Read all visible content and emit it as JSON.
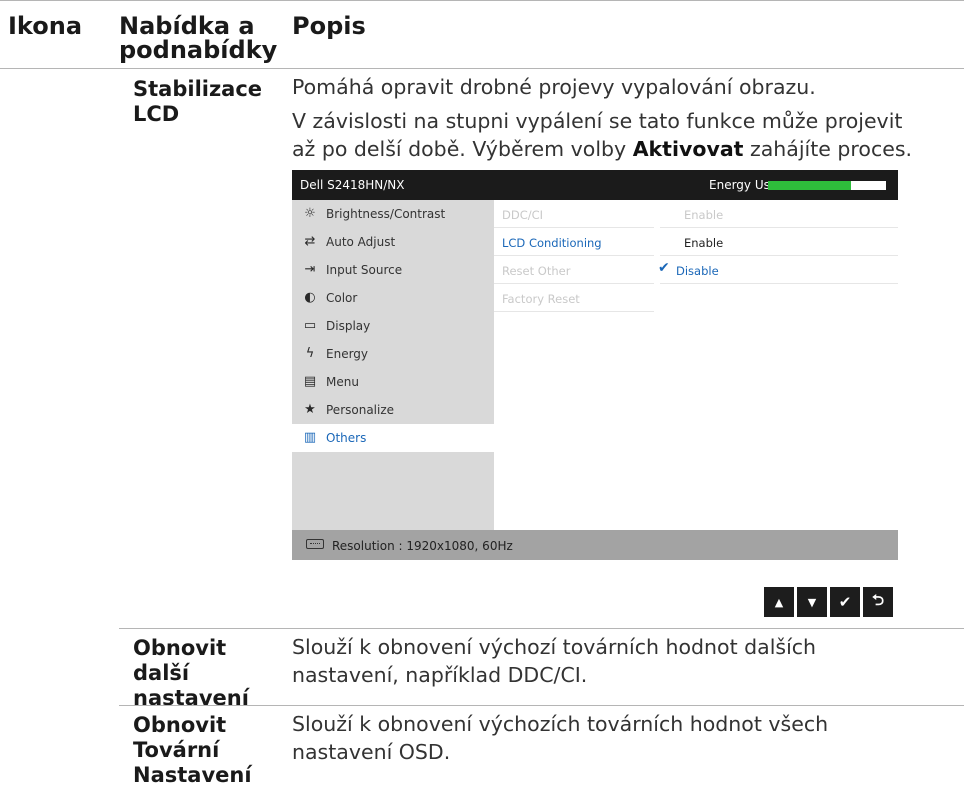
{
  "table": {
    "headers": {
      "icon": "Ikona",
      "menu_line1": "Nabídka a",
      "menu_line2": "podnabídky",
      "description": "Popis"
    },
    "rows": [
      {
        "label_lines": [
          "Stabilizace",
          "LCD"
        ],
        "paragraph1": "Pomáhá opravit drobné projevy vypalování obrazu.",
        "paragraph2_line1": "V závislosti na stupni vypálení se tato funkce může projevit",
        "paragraph2_line2_pre": "až po delší době. Výběrem volby ",
        "paragraph2_line2_bold": "Aktivovat",
        "paragraph2_line2_post": " zahájíte proces."
      },
      {
        "label_lines": [
          "Obnovit",
          "další",
          "nastavení"
        ],
        "desc_lines": [
          "Slouží k obnovení výchozí továrních hodnot dalších",
          "nastavení, například DDC/CI."
        ]
      },
      {
        "label_lines": [
          "Obnovit",
          "Tovární",
          "Nastavení"
        ],
        "desc_lines": [
          "Slouží k obnovení výchozích továrních hodnot všech",
          "nastavení OSD."
        ]
      }
    ]
  },
  "osd": {
    "model": "Dell S2418HN/NX",
    "energy_label": "Energy Use",
    "energy_level": 0.7,
    "colors": {
      "energy_fill": "#2ebd3b",
      "accent": "#1a67b8"
    },
    "sidebar": [
      {
        "label": "Brightness/Contrast",
        "icon": "sun-icon"
      },
      {
        "label": "Auto Adjust",
        "icon": "auto-adjust-icon"
      },
      {
        "label": "Input Source",
        "icon": "input-source-icon"
      },
      {
        "label": "Color",
        "icon": "color-icon"
      },
      {
        "label": "Display",
        "icon": "monitor-icon"
      },
      {
        "label": "Energy",
        "icon": "energy-icon"
      },
      {
        "label": "Menu",
        "icon": "menu-icon"
      },
      {
        "label": "Personalize",
        "icon": "star-icon"
      },
      {
        "label": "Others",
        "icon": "others-icon",
        "active": true
      }
    ],
    "options": [
      {
        "label": "DDC/CI",
        "value": "Enable"
      },
      {
        "label": "LCD Conditioning",
        "value": "Enable"
      },
      {
        "label": "Reset Other",
        "value": "Disable"
      },
      {
        "label": "Factory Reset",
        "value": ""
      }
    ],
    "footer": "Resolution : 1920x1080, 60Hz"
  },
  "nav_buttons": [
    {
      "glyph": "▲",
      "icon": "up-icon"
    },
    {
      "glyph": "▼",
      "icon": "down-icon"
    },
    {
      "glyph": "✔",
      "icon": "check-icon"
    },
    {
      "glyph": "⮌",
      "icon": "back-icon"
    }
  ]
}
